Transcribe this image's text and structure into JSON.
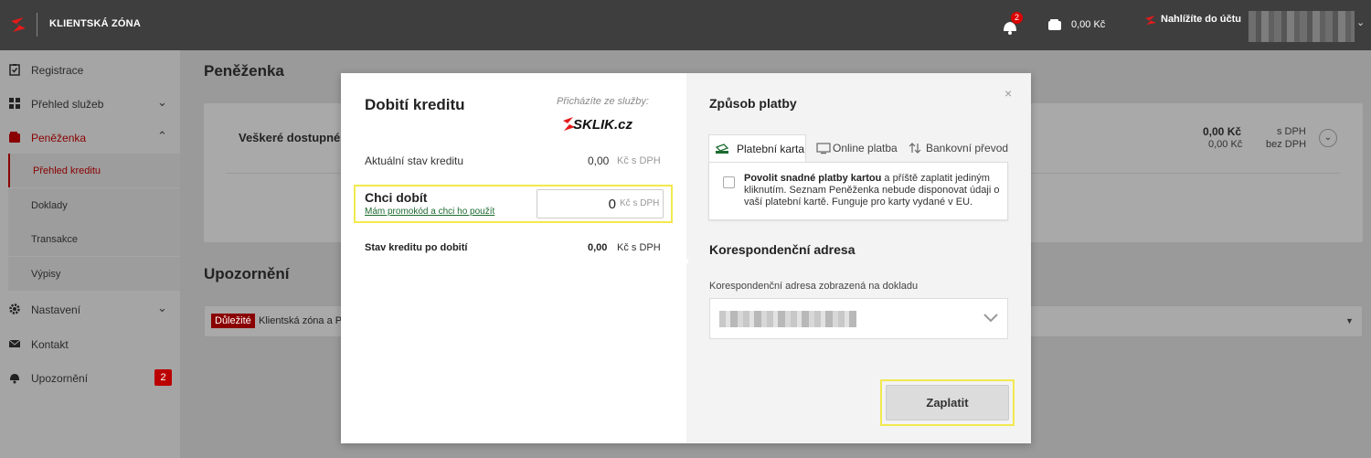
{
  "header": {
    "brand": "KLIENTSKÁ ZÓNA",
    "notifications_count": "2",
    "wallet_amount": "0,00 Kč",
    "account_label": "Nahlížíte do účtu"
  },
  "sidebar": {
    "items": [
      {
        "label": "Registrace",
        "icon": "clipboard-check-icon"
      },
      {
        "label": "Přehled služeb",
        "icon": "grid-icon"
      },
      {
        "label": "Peněženka",
        "icon": "wallet-icon"
      },
      {
        "label": "Nastavení",
        "icon": "gear-icon"
      },
      {
        "label": "Kontakt",
        "icon": "envelope-icon"
      },
      {
        "label": "Upozornění",
        "icon": "bell-icon",
        "badge": "2"
      }
    ],
    "subitems": [
      "Přehled kreditu",
      "Doklady",
      "Transakce",
      "Výpisy"
    ]
  },
  "main": {
    "title": "Peněženka",
    "card_text": "Veškeré dostupné",
    "amount_with_vat": "0,00 Kč",
    "amount_without_vat": "0,00 Kč",
    "vat_label": "s DPH",
    "no_vat_label": "bez DPH",
    "warnings_title": "Upozornění",
    "warning_tag": "Důležité",
    "warning_text": "Klientská zóna a P"
  },
  "modal": {
    "title": "Dobití kreditu",
    "from_label": "Přicházíte ze služby:",
    "service_logo_text": "SKLIK.cz",
    "current_credit_label": "Aktuální stav kreditu",
    "current_credit_value": "0,00",
    "unit_vat": "Kč s DPH",
    "want_label": "Chci dobít",
    "promo_link": "Mám promokód a chci ho použít",
    "amount_value": "0",
    "after_label": "Stav kreditu po dobití",
    "after_value": "0,00",
    "payment_title": "Způsob platby",
    "tabs": [
      {
        "label": "Platební karta",
        "icon": "card-icon"
      },
      {
        "label": "Online platba",
        "icon": "monitor-icon"
      },
      {
        "label": "Bankovní převod",
        "icon": "transfer-icon"
      }
    ],
    "card_option_bold": "Povolit snadné platby kartou",
    "card_option_text": " a příště zaplatit jediným kliknutím. Seznam Peněženka nebude disponovat údaji o vaší platební kartě. Funguje pro karty vydané v EU.",
    "address_title": "Korespondenční adresa",
    "address_label": "Korespondenční adresa zobrazená na dokladu",
    "pay_button": "Zaplatit",
    "close": "×"
  },
  "colors": {
    "accent": "#8a0000",
    "highlight": "#f2e94e",
    "link_green": "#1d6b2f"
  }
}
